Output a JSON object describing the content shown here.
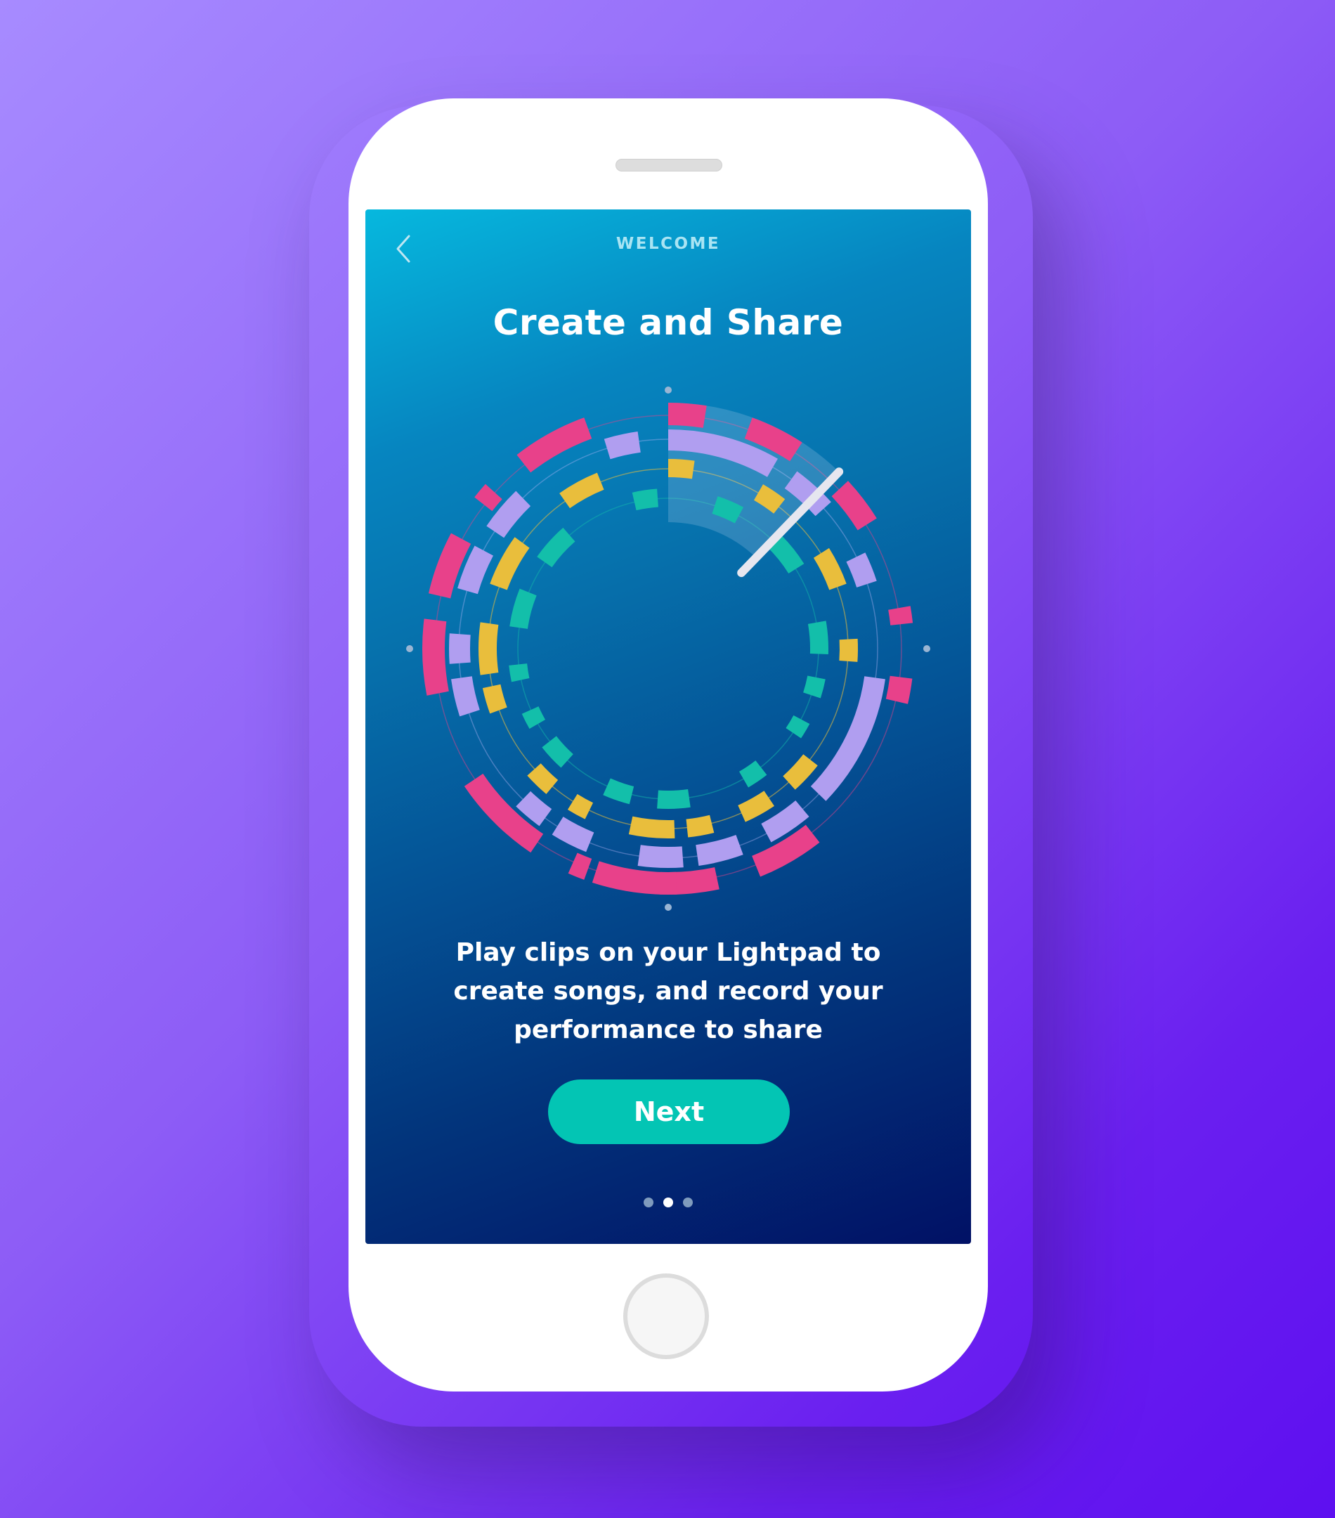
{
  "header": {
    "title": "WELCOME",
    "back_icon": "chevron-left-icon"
  },
  "onboarding": {
    "headline": "Create and Share",
    "description": "Play clips on your Lightpad to create songs, and record your performance to share",
    "next_label": "Next",
    "page_count": 3,
    "active_page": 2
  },
  "colors": {
    "pink": "#e8418a",
    "lavender": "#b09ef0",
    "yellow": "#e9be3c",
    "teal": "#13bfaa",
    "button": "#03c5b4",
    "playhead": "#e6e6ef"
  }
}
